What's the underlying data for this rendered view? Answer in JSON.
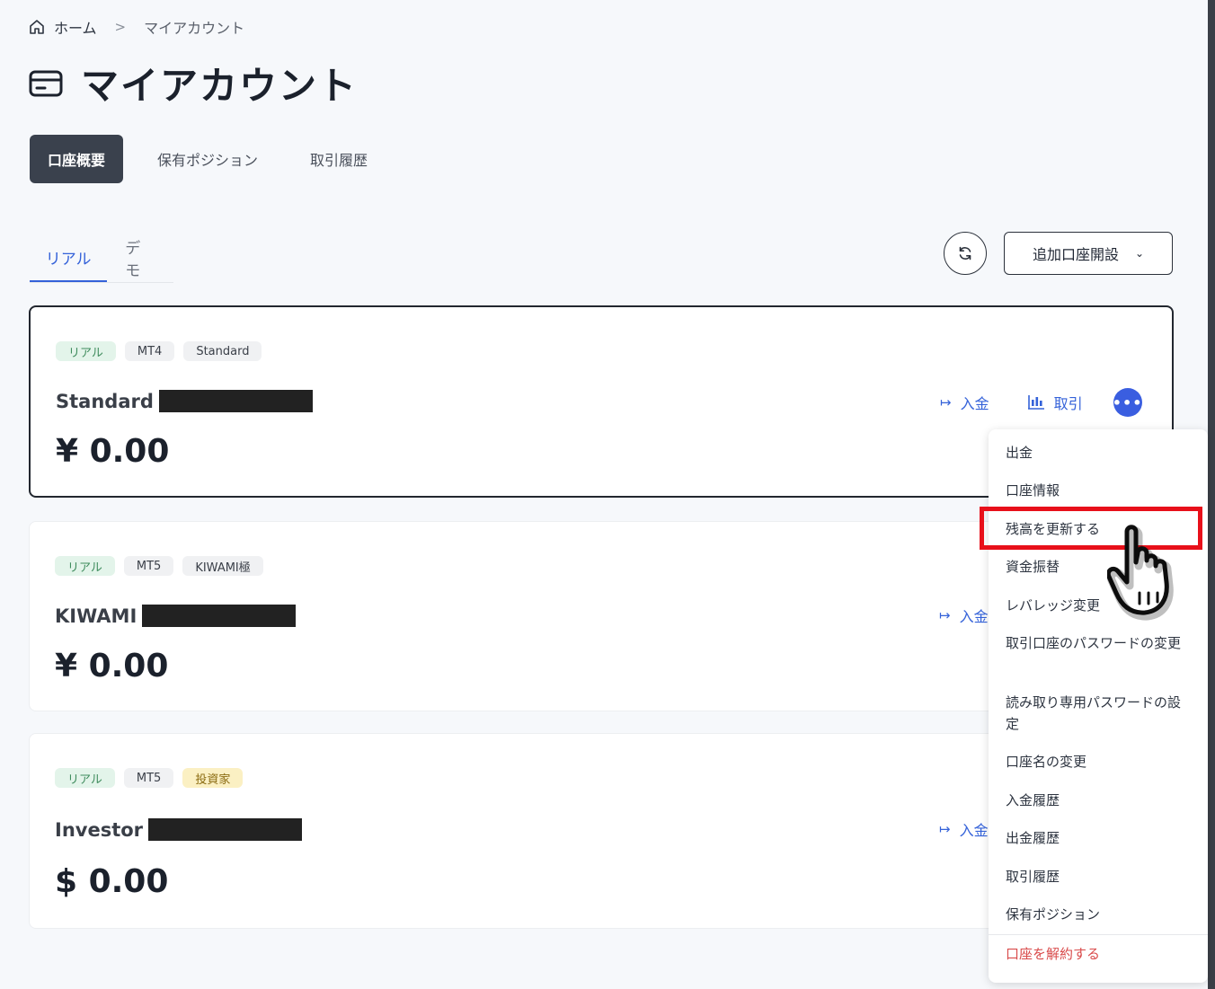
{
  "breadcrumb": {
    "home": "ホーム",
    "separator": ">",
    "current": "マイアカウント"
  },
  "page_title": "マイアカウント",
  "main_tabs": [
    {
      "label": "口座概要",
      "active": true
    },
    {
      "label": "保有ポジション",
      "active": false
    },
    {
      "label": "取引履歴",
      "active": false
    }
  ],
  "sub_tabs": [
    {
      "label": "リアル",
      "active": true
    },
    {
      "label": "デモ",
      "active": false
    }
  ],
  "toolbar": {
    "add_account_label": "追加口座開設",
    "chevron": "⌄"
  },
  "accounts": [
    {
      "badges": [
        "リアル",
        "MT4",
        "Standard"
      ],
      "name": "Standard",
      "balance": "¥ 0.00",
      "deposit_label": "入金",
      "trade_label": "取引",
      "more_label": "•••"
    },
    {
      "badges": [
        "リアル",
        "MT5",
        "KIWAMI極"
      ],
      "name": "KIWAMI",
      "balance": "¥ 0.00",
      "deposit_label": "入金"
    },
    {
      "badges": [
        "リアル",
        "MT5",
        "投資家"
      ],
      "name": "Investor",
      "balance": "$ 0.00",
      "deposit_label": "入金"
    }
  ],
  "menu": [
    "出金",
    "口座情報",
    "残高を更新する",
    "資金振替",
    "レバレッジ変更",
    "取引口座のパスワードの変更",
    "読み取り専用パスワードの設定",
    "口座名の変更",
    "入金履歴",
    "出金履歴",
    "取引履歴",
    "保有ポジション"
  ],
  "menu_danger": "口座を解約する",
  "icons": {
    "home": "home-icon",
    "title": "card-icon",
    "refresh": "refresh-icon",
    "deposit": "arrow-right-bar-icon",
    "trade": "candlestick-chart-icon",
    "more": "more-dots-icon",
    "cursor": "hand-pointer-icon"
  },
  "colors": {
    "accent": "#3462d9",
    "highlight": "#e8101a",
    "danger": "#d94b4b",
    "active_tab": "#3a414d"
  }
}
